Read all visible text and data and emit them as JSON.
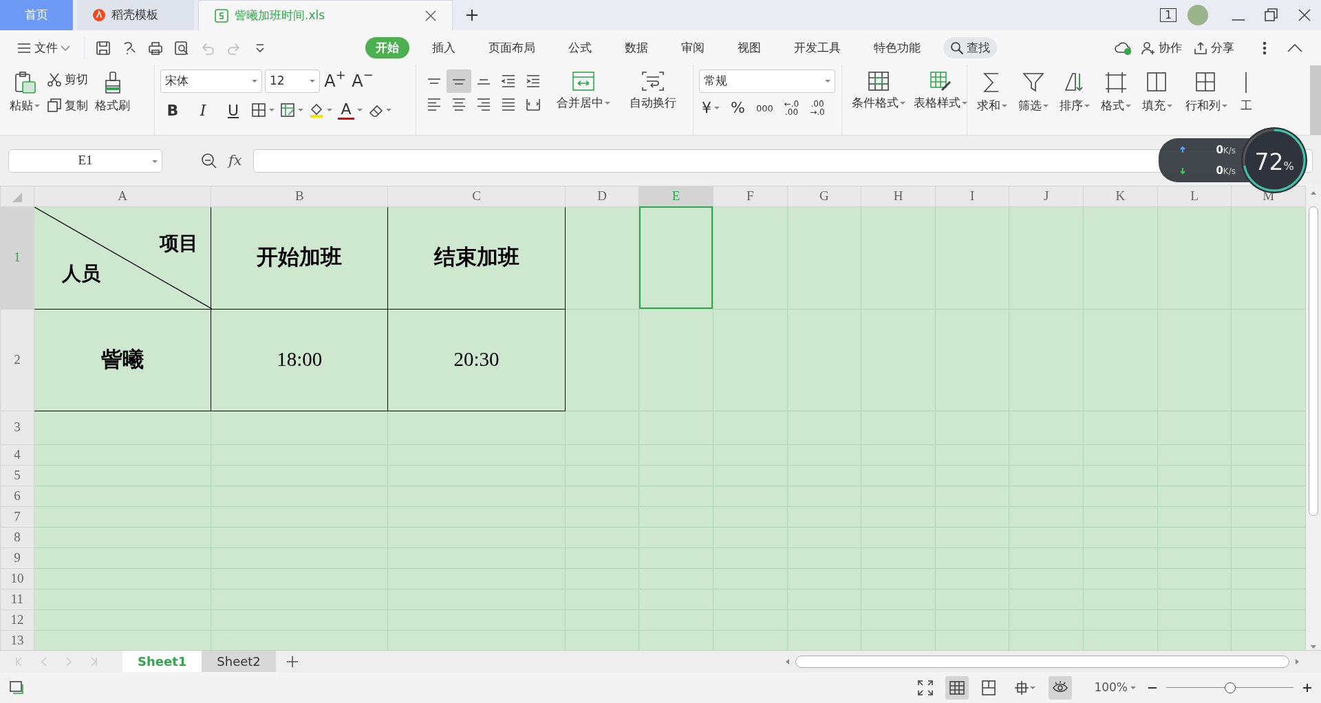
{
  "window_tabs": [
    {
      "kind": "home",
      "label": "首页",
      "selected": false
    },
    {
      "kind": "template",
      "label": "稻壳模板",
      "selected": false
    },
    {
      "kind": "sheet",
      "label": "訾曦加班时间.xls",
      "selected": true
    }
  ],
  "title_controls": {
    "window_count": "1"
  },
  "menu": {
    "file": "文件",
    "tabs": [
      {
        "label": "开始",
        "selected": true
      },
      {
        "label": "插入",
        "selected": false
      },
      {
        "label": "页面布局",
        "selected": false
      },
      {
        "label": "公式",
        "selected": false
      },
      {
        "label": "数据",
        "selected": false
      },
      {
        "label": "审阅",
        "selected": false
      },
      {
        "label": "视图",
        "selected": false
      },
      {
        "label": "开发工具",
        "selected": false
      },
      {
        "label": "特色功能",
        "selected": false
      }
    ],
    "search": "查找",
    "actions": [
      {
        "kind": "collab",
        "label": "协作"
      },
      {
        "kind": "share",
        "label": "分享"
      }
    ]
  },
  "ribbon": {
    "paste": "粘贴",
    "cut": "剪切",
    "copy": "复制",
    "painter": "格式刷",
    "font_family": "宋体",
    "font_size": "12",
    "grow": "A$^{+}$",
    "shrink": "A$^{−}$",
    "format_buttons": [
      {
        "kind": "bold",
        "label": "B"
      },
      {
        "kind": "italic",
        "label": "I"
      },
      {
        "kind": "underline",
        "label": "U"
      }
    ],
    "font_color": "A",
    "align_buttons": [
      {
        "kind": "top",
        "selected": false
      },
      {
        "kind": "middle",
        "selected": true
      },
      {
        "kind": "bottom",
        "selected": false
      },
      {
        "kind": "outdent",
        "selected": false
      },
      {
        "kind": "indent",
        "selected": false
      },
      {
        "kind": "left",
        "selected": false
      },
      {
        "kind": "center",
        "selected": false
      },
      {
        "kind": "right",
        "selected": false
      },
      {
        "kind": "justify",
        "selected": false
      },
      {
        "kind": "distributed",
        "selected": false
      }
    ],
    "merge": "合并居中",
    "wrap": "自动换行",
    "number_format": "常规",
    "number_tools": [
      {
        "kind": "currency",
        "label": "¥"
      },
      {
        "kind": "percent",
        "label": "%"
      },
      {
        "kind": "thousands",
        "label": "000"
      },
      {
        "kind": "increase",
        "top": "←.0",
        "bottom": ".00"
      },
      {
        "kind": "decrease",
        "top": ".00",
        "bottom": "→.0"
      }
    ],
    "styles": [
      {
        "kind": "conditional",
        "label": "条件格式"
      },
      {
        "kind": "table",
        "label": "表格样式"
      }
    ],
    "tools": [
      {
        "kind": "sum",
        "label": "求和"
      },
      {
        "kind": "filter",
        "label": "筛选"
      },
      {
        "kind": "sort",
        "label": "排序"
      },
      {
        "kind": "format",
        "label": "格式"
      },
      {
        "kind": "fill",
        "label": "填充"
      },
      {
        "kind": "rowcol",
        "label": "行和列"
      },
      {
        "kind": "worksheet",
        "label": "工"
      }
    ]
  },
  "net_widget": {
    "upload": "0",
    "upload_unit": "K/s",
    "download": "0",
    "download_unit": "K/s",
    "percent": "72",
    "percent_sign": "%"
  },
  "formula_bar": {
    "name_box": "E1",
    "fx": "fx"
  },
  "sheet": {
    "columns": [
      {
        "label": "A",
        "selected": false
      },
      {
        "label": "B",
        "selected": false
      },
      {
        "label": "C",
        "selected": false
      },
      {
        "label": "D",
        "selected": false
      },
      {
        "label": "E",
        "selected": true
      },
      {
        "label": "F",
        "selected": false
      },
      {
        "label": "G",
        "selected": false
      },
      {
        "label": "H",
        "selected": false
      },
      {
        "label": "I",
        "selected": false
      },
      {
        "label": "J",
        "selected": false
      },
      {
        "label": "K",
        "selected": false
      },
      {
        "label": "L",
        "selected": false
      },
      {
        "label": "M",
        "selected": false
      }
    ],
    "rows": [
      {
        "header": "1",
        "selected": true,
        "kind": "tall",
        "cells": [
          {
            "kind": "diagonal",
            "top": "项目",
            "bottom": "人员"
          },
          {
            "kind": "heading",
            "text": "开始加班"
          },
          {
            "kind": "heading",
            "text": "结束加班"
          }
        ]
      },
      {
        "header": "2",
        "selected": false,
        "kind": "tall",
        "cells": [
          {
            "kind": "name",
            "text": "訾曦"
          },
          {
            "kind": "time",
            "text": "18:00"
          },
          {
            "kind": "time",
            "text": "20:30"
          }
        ]
      },
      {
        "header": "3",
        "selected": false,
        "kind": "medium"
      },
      {
        "header": "4",
        "selected": false,
        "kind": "normal"
      },
      {
        "header": "5",
        "selected": false,
        "kind": "normal"
      },
      {
        "header": "6",
        "selected": false,
        "kind": "normal"
      },
      {
        "header": "7",
        "selected": false,
        "kind": "normal"
      },
      {
        "header": "8",
        "selected": false,
        "kind": "normal"
      },
      {
        "header": "9",
        "selected": false,
        "kind": "normal"
      },
      {
        "header": "10",
        "selected": false,
        "kind": "normal"
      },
      {
        "header": "11",
        "selected": false,
        "kind": "normal"
      },
      {
        "header": "12",
        "selected": false,
        "kind": "normal"
      },
      {
        "header": "13",
        "selected": false,
        "kind": "normal"
      }
    ]
  },
  "sheet_tabs": [
    {
      "label": "Sheet1",
      "selected": true
    },
    {
      "label": "Sheet2",
      "selected": false
    }
  ],
  "status_bar": {
    "views": [
      {
        "kind": "fullscreen",
        "selected": false
      },
      {
        "kind": "normal",
        "selected": true
      },
      {
        "kind": "pagebreak",
        "selected": false
      },
      {
        "kind": "reading",
        "selected": false
      },
      {
        "kind": "eyecare",
        "selected": true
      }
    ],
    "zoom": "100%",
    "zoom_slider": {
      "level": 0.5
    }
  }
}
